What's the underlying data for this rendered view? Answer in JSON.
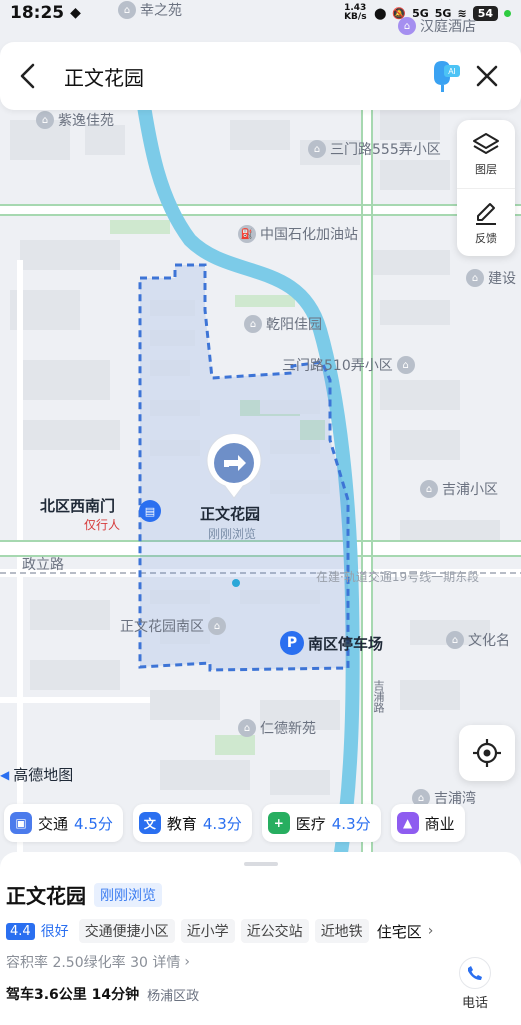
{
  "status": {
    "time": "18:25",
    "net_speed": "1.43 KB/s",
    "signal1": "5G",
    "signal2": "5G",
    "battery": "54"
  },
  "search": {
    "query": "正文花园",
    "ai_badge": "AI"
  },
  "tools": {
    "layers_label": "图层",
    "feedback_label": "反馈"
  },
  "map": {
    "logo": "高德地图",
    "labels": {
      "xingzhiyuan": "幸之苑",
      "hanting": "汉庭酒店",
      "ziyi": "紫逸佳苑",
      "sanmen555": "三门路555弄小区",
      "sinopec": "中国石化加油站",
      "jianshe": "建设",
      "qianyang": "乾阳佳园",
      "sanmen510": "三门路510弄小区",
      "jipu": "吉浦小区",
      "north_gate": "北区西南门",
      "pedestrian": "仅行人",
      "zhengwen": "正文花园",
      "recent": "刚刚浏览",
      "zhengli": "政立路",
      "metro": "在建·轨道交通19号线一期东段",
      "south": "正文花园南区",
      "parking": "南区停车场",
      "wenhua": "文化名",
      "jipu_road": "吉浦路",
      "rende": "仁德新苑",
      "jipu2": "吉浦湾"
    }
  },
  "chips": [
    {
      "icon": "train-icon",
      "label": "交通",
      "score": "4.5分",
      "color": "#4b7bec"
    },
    {
      "icon": "edu-icon",
      "label": "教育",
      "score": "4.3分",
      "color": "#2a6ff0"
    },
    {
      "icon": "medical-icon",
      "label": "医疗",
      "score": "4.3分",
      "color": "#27ae60"
    },
    {
      "icon": "shop-icon",
      "label": "商业",
      "score": "",
      "color": "#8e5cf0"
    }
  ],
  "sheet": {
    "title": "正文花园",
    "recent": "刚刚浏览",
    "rating": "4.4",
    "rating_text": "很好",
    "tags": [
      "交通便捷小区",
      "近小学",
      "近公交站",
      "近地铁"
    ],
    "type": "住宅区",
    "info": "容积率 2.50绿化率 30  详情",
    "drive": "驾车3.6公里 14分钟",
    "district": "杨浦区政",
    "phone_label": "电话"
  }
}
